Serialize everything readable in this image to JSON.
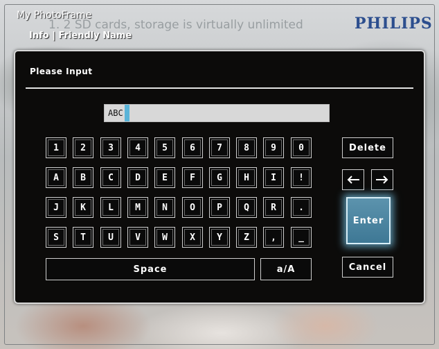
{
  "header": {
    "app_title": "My PhotoFrame",
    "background_text": "1. 2 SD cards, storage is virtually unlimited",
    "breadcrumb": "Info | Friendly Name",
    "brand": "PHILIPS"
  },
  "dialog": {
    "title": "Please Input",
    "input_value": "ABC",
    "keyboard": {
      "rows": [
        [
          "1",
          "2",
          "3",
          "4",
          "5",
          "6",
          "7",
          "8",
          "9",
          "0"
        ],
        [
          "A",
          "B",
          "C",
          "D",
          "E",
          "F",
          "G",
          "H",
          "I",
          "!"
        ],
        [
          "J",
          "K",
          "L",
          "M",
          "N",
          "O",
          "P",
          "Q",
          "R",
          "."
        ],
        [
          "S",
          "T",
          "U",
          "V",
          "W",
          "X",
          "Y",
          "Z",
          ",",
          "_"
        ]
      ],
      "space_label": "Space",
      "case_label": "a/A",
      "delete_label": "Delete",
      "enter_label": "Enter",
      "cancel_label": "Cancel"
    }
  },
  "colors": {
    "dialog_bg": "#0c0b0a",
    "enter_accent": "#4a86a3",
    "cursor": "#5ab4d8",
    "brand": "#2c4e8e"
  }
}
